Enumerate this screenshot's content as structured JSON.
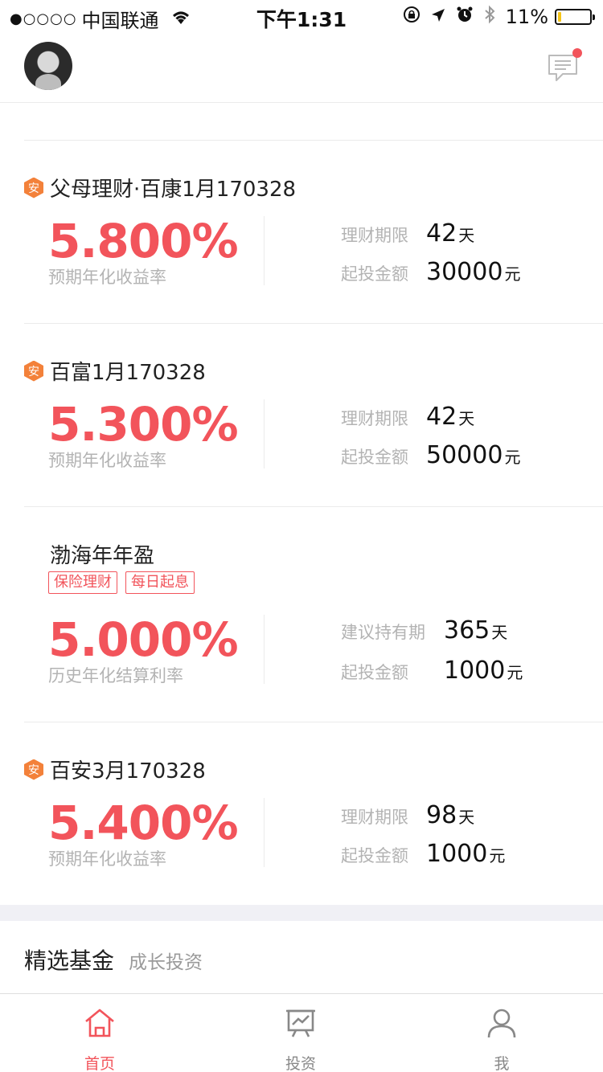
{
  "status_bar": {
    "signal": "●○○○○",
    "carrier": "中国联通",
    "time": "下午1:31",
    "battery_percent": "11%",
    "battery_level": 0.11
  },
  "header": {
    "avatar_icon": "user-avatar",
    "message_icon": "chat-message-icon",
    "has_notification": true
  },
  "products": [
    {
      "badge": "安",
      "title": "父母理财·百康1月170328",
      "rate": "5.800%",
      "rate_label": "预期年化收益率",
      "period_label": "理财期限",
      "period_value": "42",
      "period_unit": "天",
      "amount_label": "起投金额",
      "amount_value": "30000",
      "amount_unit": "元"
    },
    {
      "badge": "安",
      "title": "百富1月170328",
      "rate": "5.300%",
      "rate_label": "预期年化收益率",
      "period_label": "理财期限",
      "period_value": "42",
      "period_unit": "天",
      "amount_label": "起投金额",
      "amount_value": "50000",
      "amount_unit": "元"
    },
    {
      "title": "渤海年年盈",
      "tags": [
        "保险理财",
        "每日起息"
      ],
      "rate": "5.000%",
      "rate_label": "历史年化结算利率",
      "period_label": "建议持有期",
      "period_value": "365",
      "period_unit": "天",
      "amount_label": "起投金额",
      "amount_value": "1000",
      "amount_unit": "元"
    },
    {
      "badge": "安",
      "title": "百安3月170328",
      "rate": "5.400%",
      "rate_label": "预期年化收益率",
      "period_label": "理财期限",
      "period_value": "98",
      "period_unit": "天",
      "amount_label": "起投金额",
      "amount_value": "1000",
      "amount_unit": "元"
    }
  ],
  "section": {
    "title": "精选基金",
    "subtitle": "成长投资"
  },
  "tabbar": {
    "tabs": [
      {
        "label": "首页",
        "icon": "home-icon",
        "active": true
      },
      {
        "label": "投资",
        "icon": "invest-chart-icon",
        "active": false
      },
      {
        "label": "我",
        "icon": "profile-icon",
        "active": false
      }
    ]
  },
  "colors": {
    "accent": "#f2545b",
    "badge": "#f3813a",
    "muted": "#b3b3b3"
  }
}
